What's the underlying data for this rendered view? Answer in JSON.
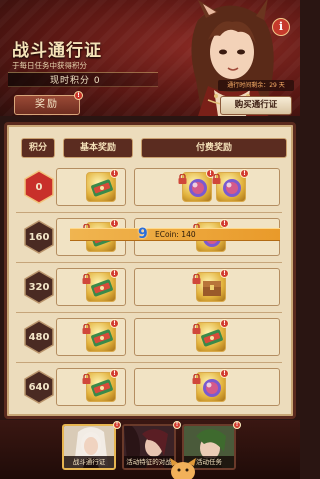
{
  "header": {
    "title": "战斗通行证",
    "subtitle": "于每日任务中获得积分",
    "points": "现时积分 0",
    "reward_button": "奖励",
    "info": "i",
    "timer": "通行时间剩余：29 天",
    "buy_button": "购买通行证"
  },
  "table": {
    "headers": {
      "points": "积分",
      "basic": "基本奖励",
      "paid": "付费奖励"
    },
    "rows": [
      {
        "level": "0",
        "active": true,
        "basic_items": 1,
        "paid_items": 2
      },
      {
        "level": "160",
        "active": false,
        "basic_items": 1,
        "paid_items": 1
      },
      {
        "level": "320",
        "active": false,
        "basic_items": 1,
        "paid_items": 1
      },
      {
        "level": "480",
        "active": false,
        "basic_items": 1,
        "paid_items": 1
      },
      {
        "level": "640",
        "active": false,
        "basic_items": 1,
        "paid_items": 1
      }
    ]
  },
  "overlay": {
    "number": "9",
    "ecoin": "ECoin: 140"
  },
  "badge": "!",
  "tabs": [
    {
      "label": "战斗通行证",
      "active": true
    },
    {
      "label": "活动特征的对战",
      "active": false
    },
    {
      "label": "活动任务",
      "active": false
    },
    {
      "label": "",
      "active": false
    }
  ],
  "colors": {
    "header_bg": "#5a1713",
    "panel_bg": "#ecdcbc",
    "accent_gold": "#e2b23c",
    "badge_red": "#c8332a"
  }
}
